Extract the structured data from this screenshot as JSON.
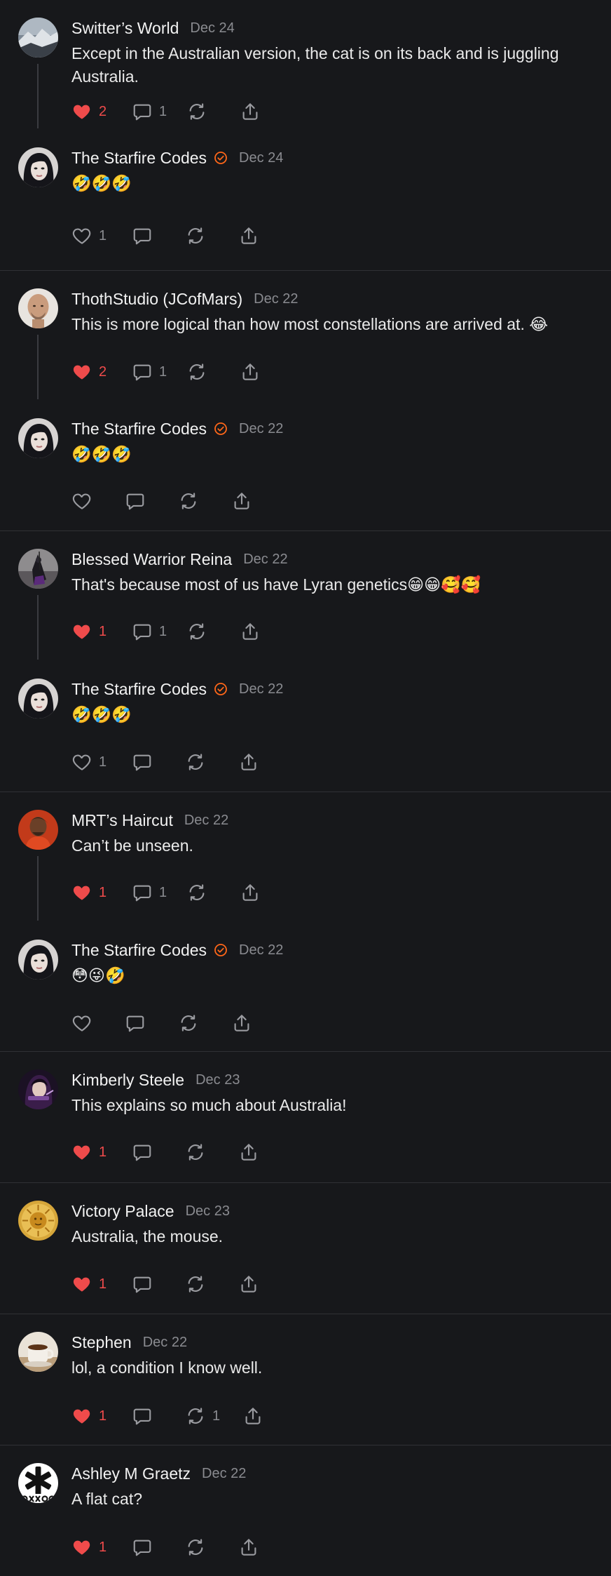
{
  "colors": {
    "background": "#17181b",
    "like_red": "#ef4b4b",
    "verified_orange": "#ff6719",
    "muted": "#8a8b90",
    "divider": "#303135"
  },
  "groups": [
    {
      "comments": [
        {
          "avatar": "avatar-mountain",
          "name": "Switter’s World",
          "verified": false,
          "date": "Dec 24",
          "text": "Except in the Australian version, the cat is on its back and is juggling Australia.",
          "likes": "2",
          "liked": true,
          "replies": "1",
          "restacks": ""
        },
        {
          "avatar": "avatar-woman",
          "name": "The Starfire Codes",
          "verified": true,
          "date": "Dec 24",
          "text": "🤣🤣🤣",
          "likes": "1",
          "liked": false,
          "replies": "",
          "restacks": ""
        }
      ]
    },
    {
      "comments": [
        {
          "avatar": "avatar-bald-man",
          "name": "ThothStudio (JCofMars)",
          "verified": false,
          "date": "Dec 22",
          "text": "This is more logical than how most constellations are arrived at. 😂",
          "likes": "2",
          "liked": true,
          "replies": "1",
          "restacks": ""
        },
        {
          "avatar": "avatar-woman",
          "name": "The Starfire Codes",
          "verified": true,
          "date": "Dec 22",
          "text": "🤣🤣🤣",
          "likes": "",
          "liked": false,
          "replies": "",
          "restacks": ""
        }
      ]
    },
    {
      "comments": [
        {
          "avatar": "avatar-warrior",
          "name": "Blessed Warrior Reina",
          "verified": false,
          "date": "Dec 22",
          "text": "That's because most of us have Lyran genetics😁😁🥰🥰",
          "likes": "1",
          "liked": true,
          "replies": "1",
          "restacks": ""
        },
        {
          "avatar": "avatar-woman",
          "name": "The Starfire Codes",
          "verified": true,
          "date": "Dec 22",
          "text": "🤣🤣🤣",
          "likes": "1",
          "liked": false,
          "replies": "",
          "restacks": ""
        }
      ]
    },
    {
      "comments": [
        {
          "avatar": "avatar-red",
          "name": "MRT’s Haircut",
          "verified": false,
          "date": "Dec 22",
          "text": "Can’t be unseen.",
          "likes": "1",
          "liked": true,
          "replies": "1",
          "restacks": ""
        },
        {
          "avatar": "avatar-woman",
          "name": "The Starfire Codes",
          "verified": true,
          "date": "Dec 22",
          "text": "😳😜🤣",
          "likes": "",
          "liked": false,
          "replies": "",
          "restacks": ""
        }
      ]
    },
    {
      "comments": [
        {
          "avatar": "avatar-purple",
          "name": "Kimberly Steele",
          "verified": false,
          "date": "Dec 23",
          "text": "This explains so much about Australia!",
          "likes": "1",
          "liked": true,
          "replies": "",
          "restacks": ""
        }
      ]
    },
    {
      "comments": [
        {
          "avatar": "avatar-sun",
          "name": "Victory Palace",
          "verified": false,
          "date": "Dec 23",
          "text": "Australia, the mouse.",
          "likes": "1",
          "liked": true,
          "replies": "",
          "restacks": ""
        }
      ]
    },
    {
      "comments": [
        {
          "avatar": "avatar-coffee",
          "name": "Stephen",
          "verified": false,
          "date": "Dec 22",
          "text": "lol, a condition I know well.",
          "likes": "1",
          "liked": true,
          "replies": "",
          "restacks": "1"
        }
      ]
    },
    {
      "comments": [
        {
          "avatar": "avatar-asterisk",
          "name": "Ashley M Graetz",
          "verified": false,
          "date": "Dec 22",
          "text": "A flat cat?",
          "likes": "1",
          "liked": true,
          "replies": "",
          "restacks": ""
        }
      ]
    }
  ]
}
